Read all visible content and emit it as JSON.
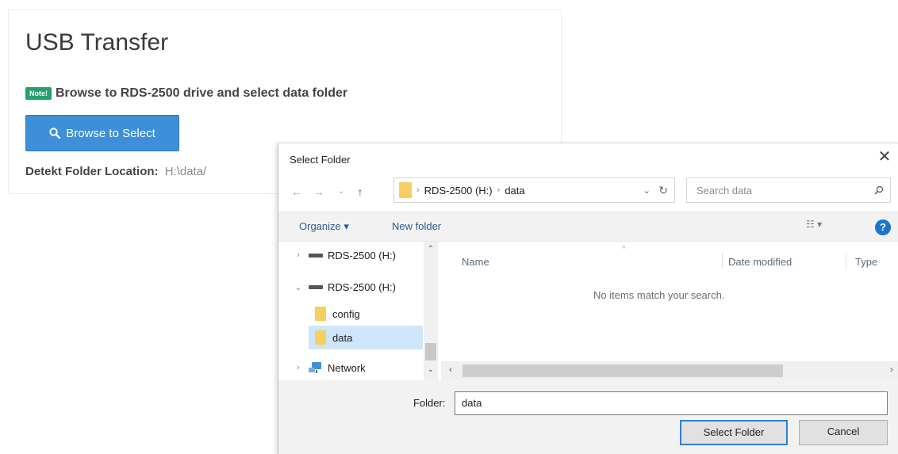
{
  "panel": {
    "title": "USB Transfer",
    "note_badge": "Note!",
    "note_text": "Browse to RDS-2500 drive and select data folder",
    "browse_button": "Browse to Select",
    "location_label": "Detekt Folder Location:",
    "location_value": "H:\\data/",
    "accent_color": "#3c8fd8",
    "badge_color": "#27a06b"
  },
  "dialog": {
    "title": "Select Folder",
    "close_glyph": "✕",
    "address": {
      "crumbs": [
        "RDS-2500 (H:)",
        "data"
      ],
      "separator": "›"
    },
    "search_placeholder": "Search data",
    "toolbar": {
      "organize": "Organize ▾",
      "new_folder": "New folder",
      "view_glyph": "☷ ▾",
      "help_glyph": "?"
    },
    "tree": [
      {
        "label": "RDS-2500 (H:)",
        "chevron": "›",
        "icon": "drive-icon"
      },
      {
        "label": "RDS-2500 (H:)",
        "chevron": "⌄",
        "icon": "drive-icon"
      },
      {
        "label": "config",
        "chevron": "",
        "icon": "folder-icon"
      },
      {
        "label": "data",
        "chevron": "",
        "icon": "folder-icon",
        "selected": true
      },
      {
        "label": "Network",
        "chevron": "›",
        "icon": "network-icon"
      }
    ],
    "columns": [
      "Name",
      "Date modified",
      "Type"
    ],
    "empty_message": "No items match your search.",
    "folder_label": "Folder:",
    "folder_value": "data",
    "select_button": "Select Folder",
    "cancel_button": "Cancel"
  }
}
